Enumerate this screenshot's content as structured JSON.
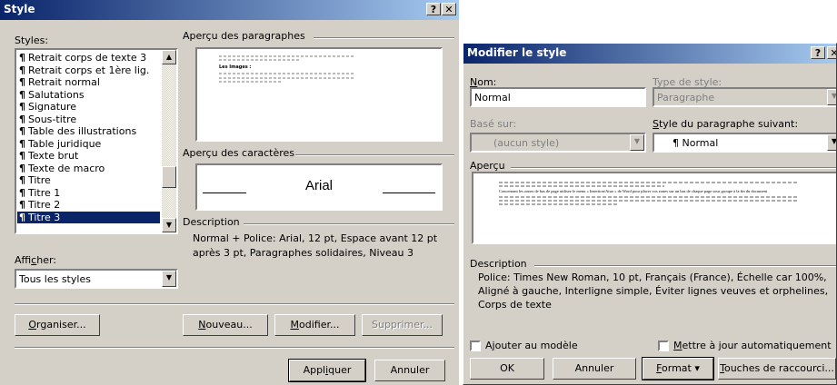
{
  "style_dialog": {
    "title": "Style",
    "help_btn": "?",
    "close_btn": "✕",
    "styles_label": "Styles:",
    "styles_list": [
      "Retrait corps de texte 3",
      "Retrait corps et 1ère lig.",
      "Retrait normal",
      "Salutations",
      "Signature",
      "Sous-titre",
      "Table des illustrations",
      "Table juridique",
      "Texte brut",
      "Texte de macro",
      "Titre",
      "Titre 1",
      "Titre 2",
      "Titre 3"
    ],
    "selected_style": "Titre 3",
    "para_preview_label": "Aperçu des paragraphes",
    "para_preview_heading": "Les Images :",
    "char_preview_label": "Aperçu des caractères",
    "char_preview_font": "Arial",
    "description_label": "Description",
    "description_text": "Normal + Police: Arial, 12 pt, Espace avant 12 pt après 3 pt, Paragraphes solidaires, Niveau 3",
    "show_label": "Afficher:",
    "show_value": "Tous les styles",
    "btn_organiser": "Organiser...",
    "btn_nouveau": "Nouveau...",
    "btn_modifier": "Modifier...",
    "btn_supprimer": "Supprimer...",
    "btn_appliquer": "Appliquer",
    "btn_annuler": "Annuler"
  },
  "modify_dialog": {
    "title": "Modifier le style",
    "help_btn": "?",
    "close_btn": "✕",
    "name_label": "Nom:",
    "name_value": "Normal",
    "type_label": "Type de style:",
    "type_value": "Paragraphe",
    "based_label": "Basé sur:",
    "based_value": "(aucun style)",
    "next_label": "Style du paragraphe suivant:",
    "next_value": "¶ Normal",
    "preview_label": "Aperçu",
    "preview_main_text": "Concernant les zones de bas de page utilisez le menu « Insertion/Atuo » de Word pour placer vos zones sur un bas de chaque page sous groupe à la fin du document",
    "description_label": "Description",
    "description_text": "Police: Times New Roman, 10 pt, Français (France), Échelle car 100%, Aligné à gauche, Interligne simple, Éviter lignes veuves et orphelines, Corps de texte",
    "add_template_label": "Ajouter au modèle",
    "auto_update_label": "Mettre à jour automatiquement",
    "btn_ok": "OK",
    "btn_annuler": "Annuler",
    "btn_format": "Format ▾",
    "btn_touches": "Touches de raccourci..."
  },
  "colors": {
    "face": "#d4d0c8",
    "title_start": "#0a246a",
    "title_end": "#a6caf0",
    "selection": "#0a246a"
  }
}
